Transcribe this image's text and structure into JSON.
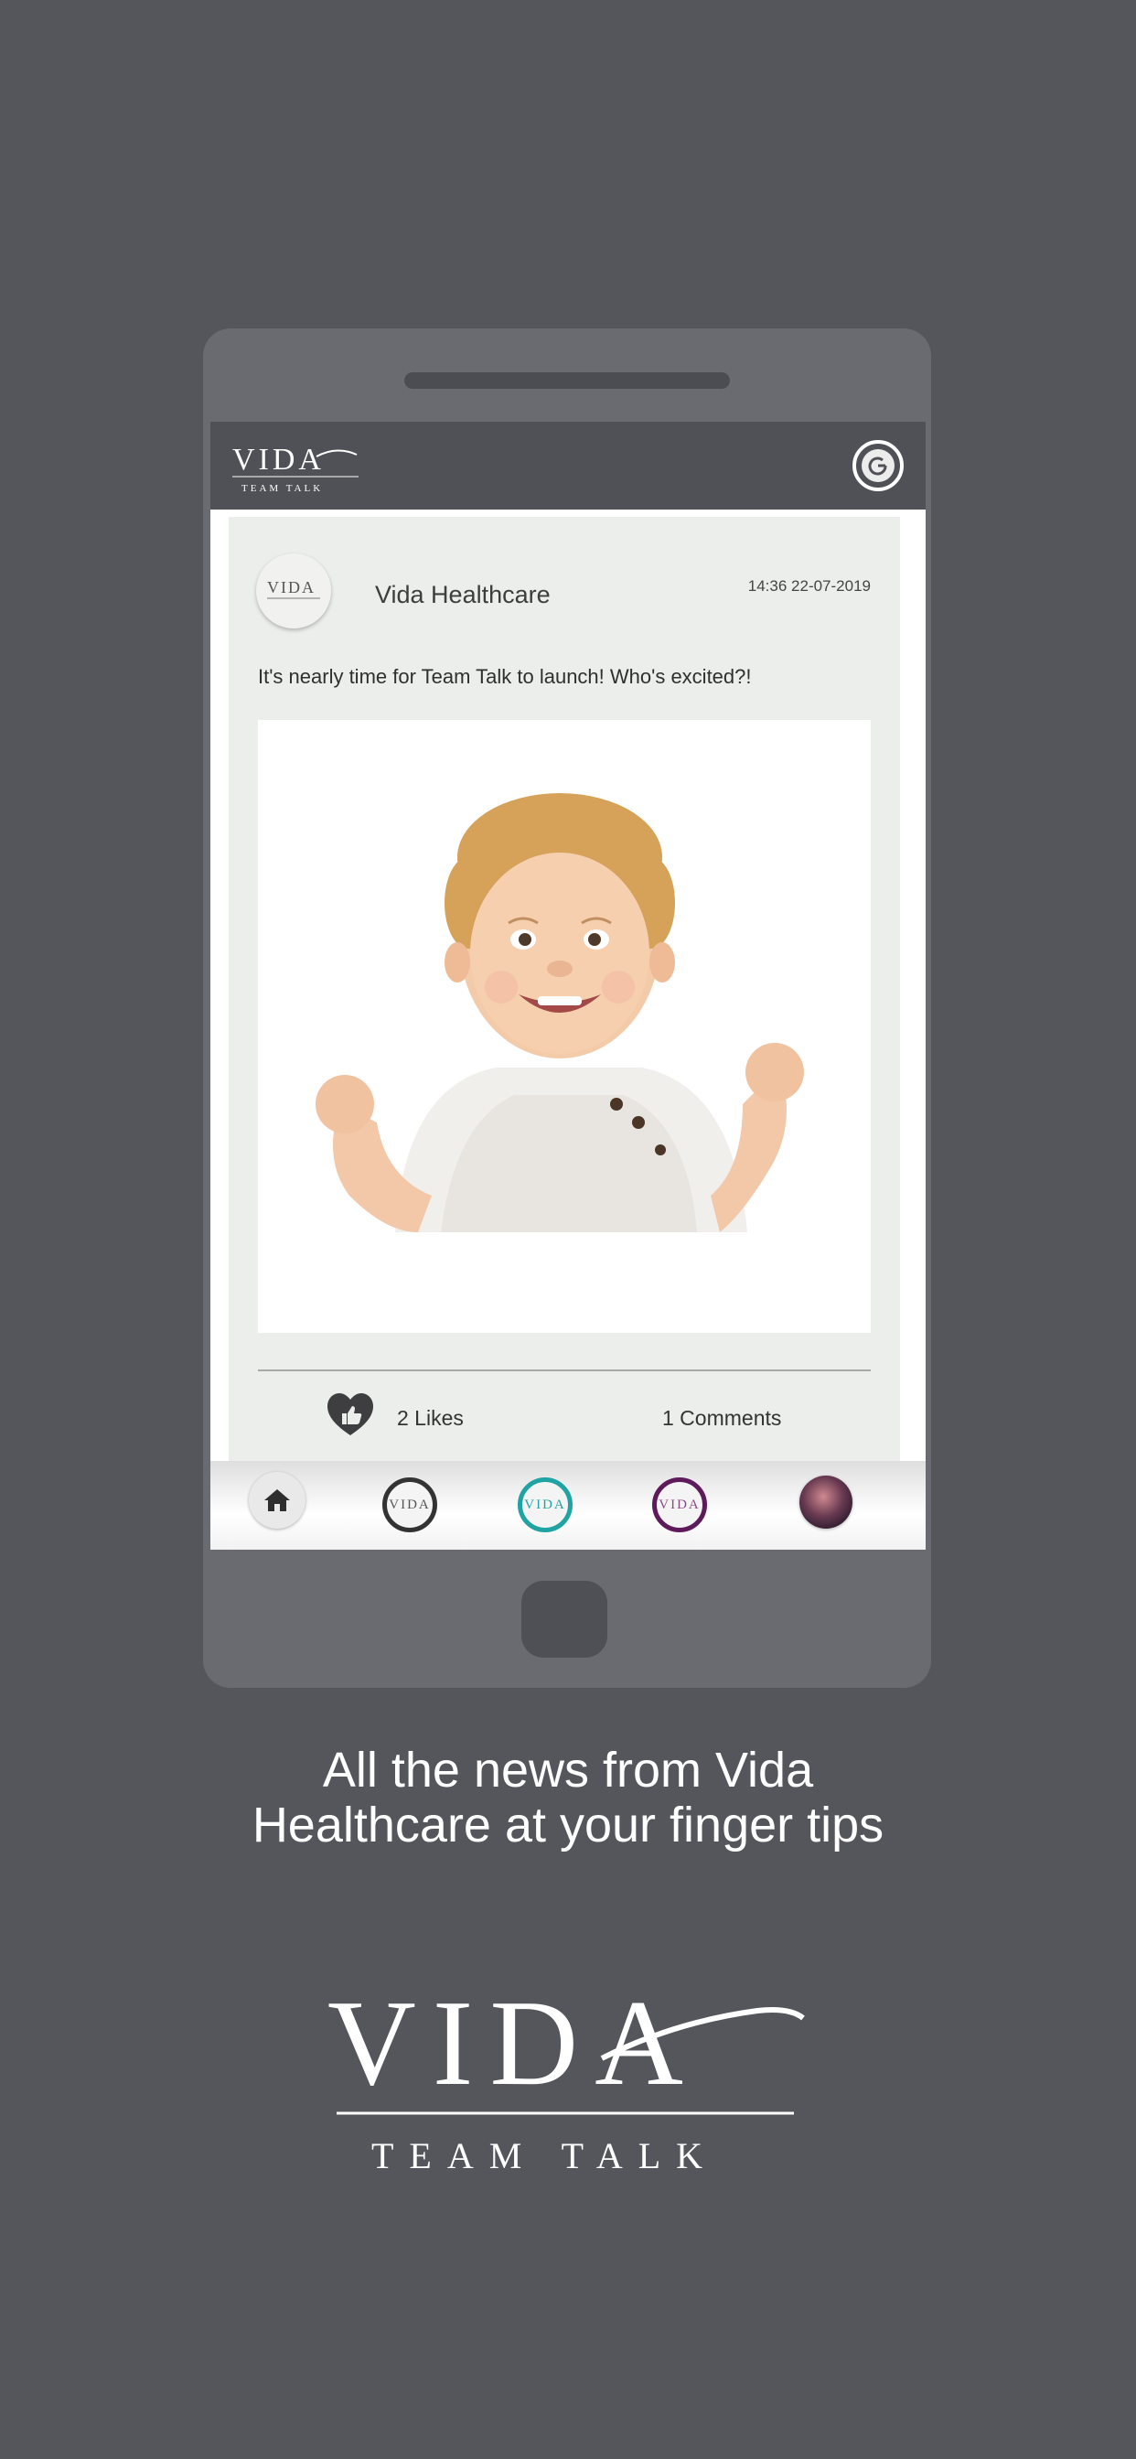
{
  "header": {
    "logo_main": "VIDA",
    "logo_sub": "TEAM TALK",
    "power_icon": "power-icon"
  },
  "post": {
    "author_name": "Vida Healthcare",
    "avatar_logo": "VIDA",
    "timestamp": "14:36 22-07-2019",
    "text": "It's nearly time for Team Talk to launch! Who's excited?!",
    "image_subject": "baby-photo",
    "likes_label": "2 Likes",
    "comments_label": "1 Comments"
  },
  "bottom_nav": {
    "items": [
      {
        "icon": "home-icon"
      },
      {
        "label": "VIDA",
        "ring_color": "#333333"
      },
      {
        "label": "VIDA",
        "ring_color": "#1fa3a3"
      },
      {
        "label": "VIDA",
        "ring_color": "#5e1a5a"
      },
      {
        "icon": "profile-avatar"
      }
    ]
  },
  "promo": {
    "tagline_line1": "All the news from Vida",
    "tagline_line2": "Healthcare at your finger tips",
    "logo_main": "VIDA",
    "logo_sub": "TEAM TALK"
  }
}
